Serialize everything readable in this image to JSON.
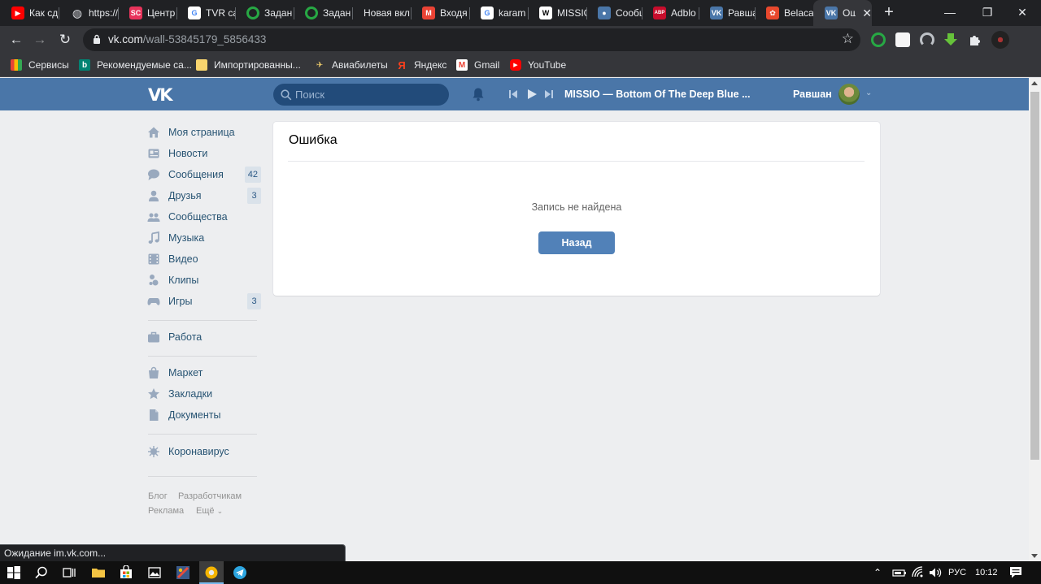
{
  "browser": {
    "tabs": [
      {
        "title": "Как сд",
        "favicon": "youtube-icon",
        "color": "#ff0000"
      },
      {
        "title": "https://",
        "favicon": "globe-icon",
        "color": "#dadce0"
      },
      {
        "title": "Центр",
        "favicon": "sc-icon",
        "color": "#e8345b"
      },
      {
        "title": "TVR са",
        "favicon": "google-icon",
        "color": "#ffffff"
      },
      {
        "title": "Задан",
        "favicon": "ring-icon",
        "color": "#27a844"
      },
      {
        "title": "Задан",
        "favicon": "ring-icon",
        "color": "#27a844"
      },
      {
        "title": "Новая вкл",
        "favicon": "",
        "color": ""
      },
      {
        "title": "Входя",
        "favicon": "gmail-icon",
        "color": "#ea4335"
      },
      {
        "title": "karam",
        "favicon": "google-icon",
        "color": "#ffffff"
      },
      {
        "title": "MISSIO",
        "favicon": "wikipedia-icon",
        "color": "#ffffff"
      },
      {
        "title": "Сообщ",
        "favicon": "vk-messages-icon",
        "color": "#4a76a8"
      },
      {
        "title": "Adblo",
        "favicon": "abp-icon",
        "color": "#c70d2c"
      },
      {
        "title": "Равша",
        "favicon": "vk-icon",
        "color": "#4a76a8"
      },
      {
        "title": "Belaca",
        "favicon": "belaca-icon",
        "color": "#e8482d"
      },
      {
        "title": "Ош",
        "favicon": "vk-icon",
        "color": "#4a76a8",
        "active": true
      }
    ],
    "url_host": "vk.com",
    "url_path": "/wall-53845179_5856433",
    "bookmarks": [
      {
        "label": "Сервисы",
        "icon": "apps-grid-icon"
      },
      {
        "label": "Рекомендуемые са...",
        "icon": "bing-icon"
      },
      {
        "label": "Импортированны...",
        "icon": "folder-icon"
      },
      {
        "label": "Авиабилеты",
        "icon": "plane-icon"
      },
      {
        "label": "Яндекс",
        "icon": "yandex-icon"
      },
      {
        "label": "Gmail",
        "icon": "gmail-icon"
      },
      {
        "label": "YouTube",
        "icon": "youtube-icon"
      }
    ],
    "status_text": "Ожидание im.vk.com..."
  },
  "vk": {
    "logo": "VK",
    "search_placeholder": "Поиск",
    "track": "MISSIO — Bottom Of The Deep Blue ...",
    "user_name": "Равшан",
    "menu": [
      {
        "label": "Моя страница",
        "icon": "home-icon"
      },
      {
        "label": "Новости",
        "icon": "news-icon"
      },
      {
        "label": "Сообщения",
        "icon": "messages-icon",
        "count": "42"
      },
      {
        "label": "Друзья",
        "icon": "friends-icon",
        "count": "3"
      },
      {
        "label": "Сообщества",
        "icon": "groups-icon"
      },
      {
        "label": "Музыка",
        "icon": "music-icon"
      },
      {
        "label": "Видео",
        "icon": "video-icon"
      },
      {
        "label": "Клипы",
        "icon": "clips-icon"
      },
      {
        "label": "Игры",
        "icon": "games-icon",
        "count": "3"
      },
      {
        "label": "Работа",
        "icon": "work-icon"
      },
      {
        "label": "Маркет",
        "icon": "market-icon"
      },
      {
        "label": "Закладки",
        "icon": "bookmarks-icon"
      },
      {
        "label": "Документы",
        "icon": "documents-icon"
      },
      {
        "label": "Коронавирус",
        "icon": "coronavirus-icon"
      }
    ],
    "footer_links": [
      "Блог",
      "Разработчикам",
      "Реклама",
      "Ещё"
    ],
    "error": {
      "title": "Ошибка",
      "message": "Запись не найдена",
      "back_label": "Назад"
    }
  },
  "taskbar": {
    "language": "РУС",
    "time": "10:12"
  },
  "colors": {
    "vk_header": "#4a76a8",
    "vk_button": "#5181b8",
    "link": "#285473",
    "page_bg": "#edeef0"
  }
}
